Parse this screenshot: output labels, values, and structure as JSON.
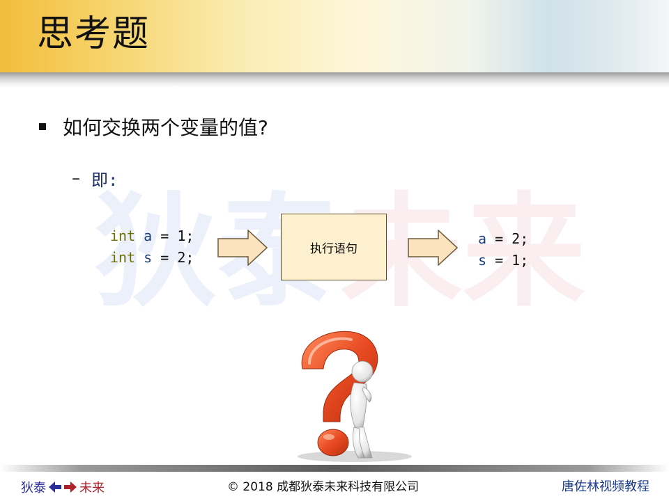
{
  "slide": {
    "title": "思考题",
    "bullet_1": "如何交换两个变量的值?",
    "bullet_2_marker": "–",
    "bullet_2": "即:"
  },
  "watermark": {
    "chars": [
      "狄",
      "泰",
      "未",
      "来"
    ],
    "colors": [
      "#ecf0fa",
      "#ecf0fa",
      "#fbeef0",
      "#fbeef0"
    ]
  },
  "diagram": {
    "left_code": [
      {
        "keyword": "int",
        "var": "a",
        "rest": " = 1;"
      },
      {
        "keyword": "int",
        "var": "s",
        "rest": " = 2;"
      }
    ],
    "process_label": "执行语句",
    "right_code": [
      {
        "var": "a",
        "rest": " = 2;"
      },
      {
        "var": "s",
        "rest": " = 1;"
      }
    ]
  },
  "footer": {
    "brand_left": "狄泰",
    "brand_right": "未来",
    "copyright": "© 2018 成都狄泰未来科技有限公司",
    "author": "唐佐林视频教程"
  },
  "colors": {
    "header_gold": "#f2bd3c",
    "header_blue": "#cfe1ea",
    "box_fill": "#fdf0cf",
    "arrow_fill": "#fbe3c0",
    "keyword": "#6f6f00",
    "variable": "#1f3f7a",
    "brand_blue": "#2a2f9a",
    "brand_red": "#b0202a",
    "question_mark": "#e84a22"
  },
  "icons": {
    "bullet": "square-bullet",
    "arrows": "right-arrow",
    "footer": "bidirectional-arrow-icon",
    "figure": "question-mark-thinker-figure"
  }
}
